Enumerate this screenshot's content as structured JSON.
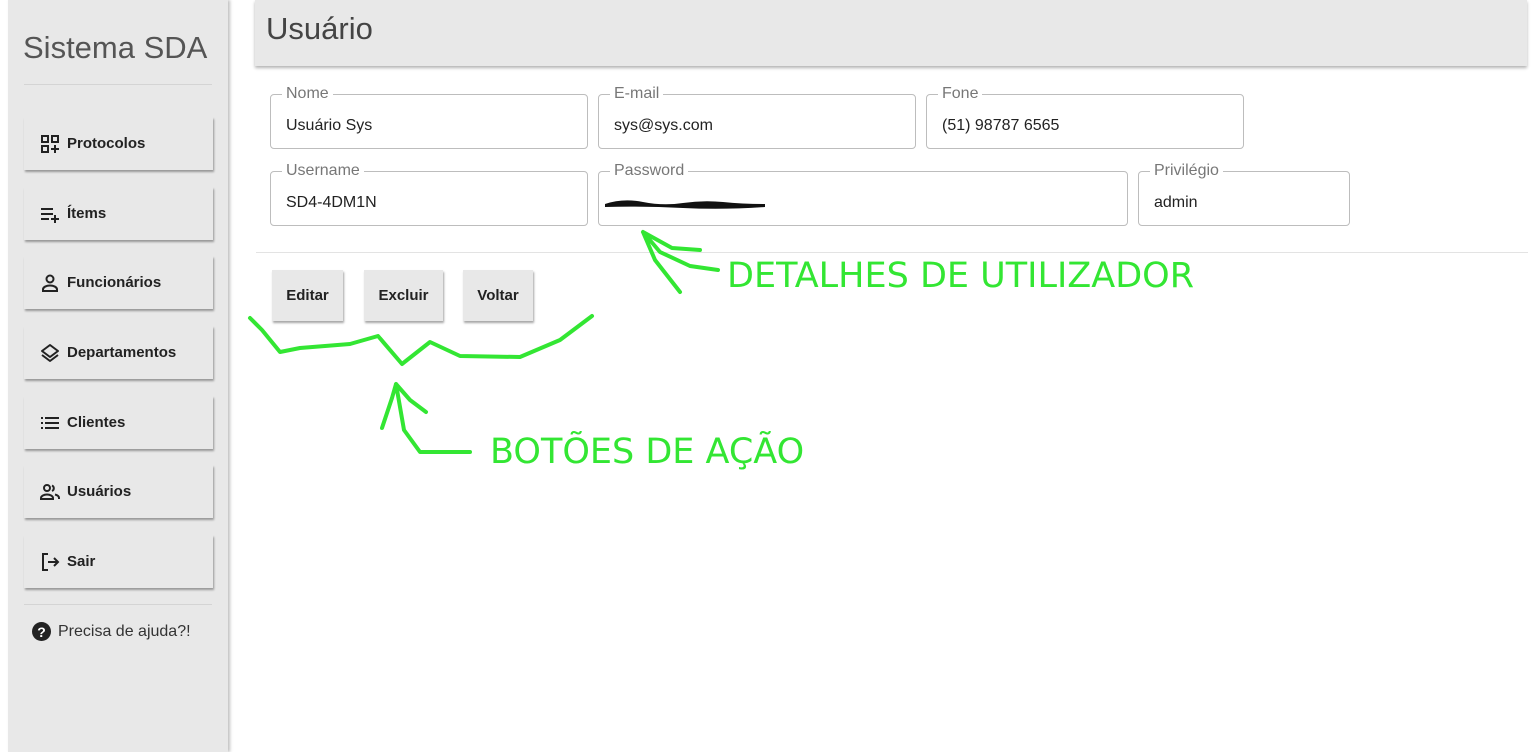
{
  "app": {
    "title": "Sistema SDA"
  },
  "sidebar": {
    "items": [
      {
        "label": "Protocolos",
        "icon": "protocols-grid-icon"
      },
      {
        "label": "Ítems",
        "icon": "list-add-icon"
      },
      {
        "label": "Funcionários",
        "icon": "person-icon"
      },
      {
        "label": "Departamentos",
        "icon": "layers-icon"
      },
      {
        "label": "Clientes",
        "icon": "list-icon"
      },
      {
        "label": "Usuários",
        "icon": "people-icon"
      },
      {
        "label": "Sair",
        "icon": "logout-icon"
      }
    ],
    "help": {
      "label": "Precisa de ajuda?!",
      "icon": "help-circle-icon"
    }
  },
  "header": {
    "title": "Usuário"
  },
  "form": {
    "nome": {
      "label": "Nome",
      "value": "Usuário Sys"
    },
    "email": {
      "label": "E-mail",
      "value": "sys@sys.com"
    },
    "fone": {
      "label": "Fone",
      "value": "(51) 98787 6565"
    },
    "username": {
      "label": "Username",
      "value": "SD4-4DM1N"
    },
    "password": {
      "label": "Password",
      "value": ""
    },
    "privilegio": {
      "label": "Privilégio",
      "value": "admin"
    }
  },
  "actions": {
    "edit": "Editar",
    "delete": "Excluir",
    "back": "Voltar"
  },
  "annotations": {
    "user_details": "DETALHES DE UTILIZADOR",
    "action_buttons": "BOTÕES DE AÇÃO",
    "color": "#33e633"
  }
}
